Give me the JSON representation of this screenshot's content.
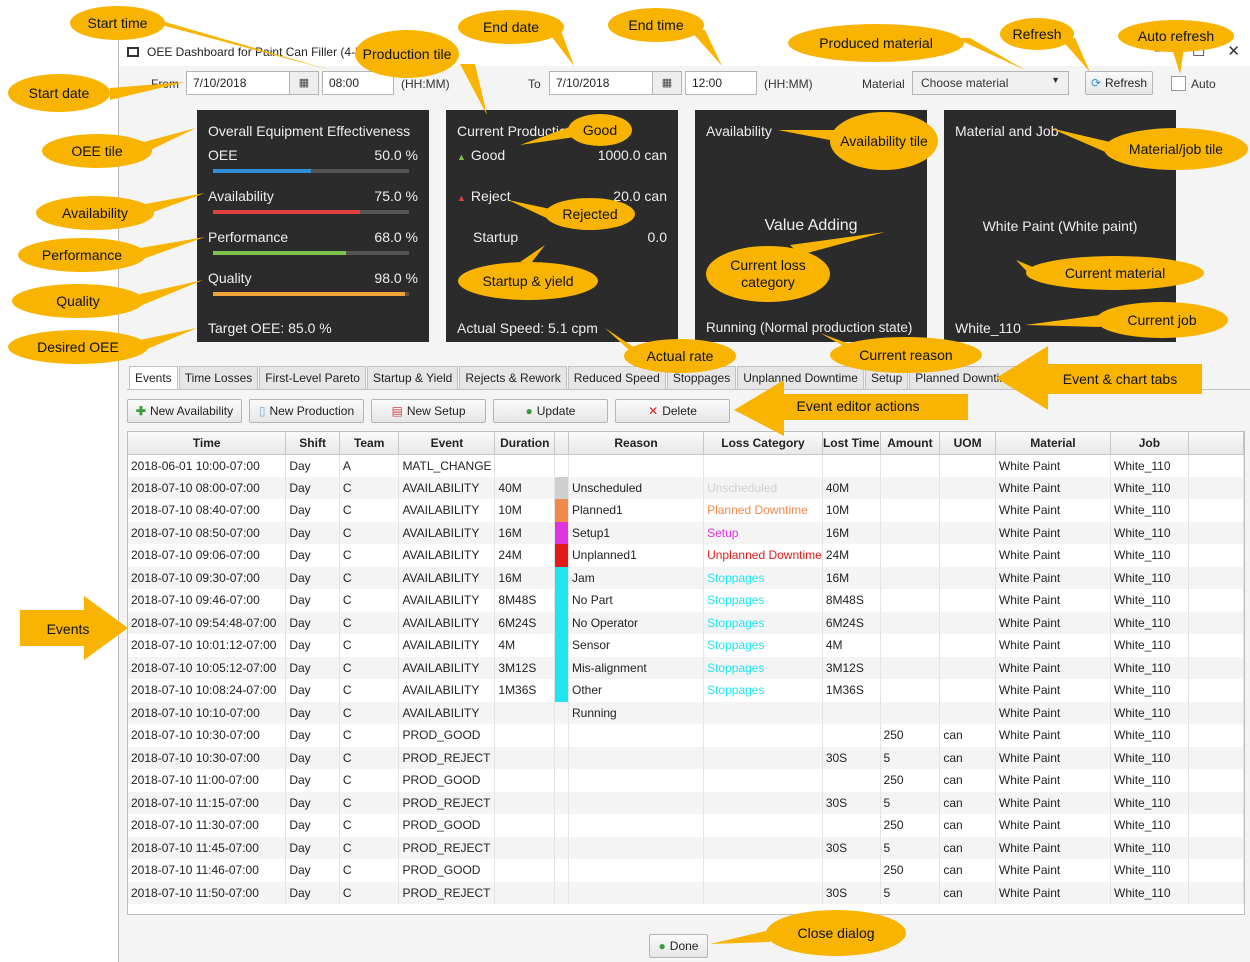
{
  "window": {
    "title": "OEE Dashboard for Paint Can Filler (4-liter machine)",
    "min": "—",
    "max": "☐",
    "close": "✕"
  },
  "range": {
    "from_label": "From",
    "start_date": "7/10/2018",
    "start_time": "08:00",
    "hhmm1": "(HH:MM)",
    "to_label": "To",
    "end_date": "7/10/2018",
    "end_time": "12:00",
    "hhmm2": "(HH:MM)",
    "material_label": "Material",
    "material_placeholder": "Choose material",
    "refresh_label": "Refresh",
    "auto_label": "Auto"
  },
  "oee": {
    "title": "Overall Equipment Effectiveness",
    "rows": [
      {
        "label": "OEE",
        "value": "50.0 %",
        "pct": 0.5,
        "color": "#2f8fd8"
      },
      {
        "label": "Availability",
        "value": "75.0 %",
        "pct": 0.75,
        "color": "#e0413f"
      },
      {
        "label": "Performance",
        "value": "68.0 %",
        "pct": 0.68,
        "color": "#7cc34c"
      },
      {
        "label": "Quality",
        "value": "98.0 %",
        "pct": 0.98,
        "color": "#f0a33a"
      }
    ],
    "target": "Target OEE: 85.0 %"
  },
  "production": {
    "title": "Current Production",
    "good_label": "Good",
    "good_value": "1000.0 can",
    "reject_label": "Reject",
    "reject_value": "20.0 can",
    "startup_label": "Startup",
    "startup_value": "0.0",
    "speed": "Actual Speed: 5.1 cpm"
  },
  "availability": {
    "title": "Availability",
    "category": "Value Adding",
    "reason": "Running (Normal production state)"
  },
  "material": {
    "title": "Material and Job",
    "material": "White Paint (White paint)",
    "job": "White_110"
  },
  "tabs": [
    "Events",
    "Time Losses",
    "First-Level Pareto",
    "Startup & Yield",
    "Rejects & Rework",
    "Reduced Speed",
    "Stoppages",
    "Unplanned Downtime",
    "Setup",
    "Planned Downtime"
  ],
  "actions": {
    "new_availability": "New Availability",
    "new_production": "New Production",
    "new_setup": "New Setup",
    "update": "Update",
    "delete": "Delete"
  },
  "columns": [
    "Time",
    "Shift",
    "Team",
    "Event",
    "Duration",
    "",
    "Reason",
    "Loss Category",
    "Lost Time",
    "Amount",
    "UOM",
    "Material",
    "Job"
  ],
  "rows": [
    [
      "2018-06-01 10:00-07:00",
      "Day",
      "A",
      "MATL_CHANGE",
      "",
      "",
      "",
      "",
      "",
      "",
      "",
      "White Paint",
      "White_110"
    ],
    [
      "2018-07-10 08:00-07:00",
      "Day",
      "C",
      "AVAILABILITY",
      "40M",
      "#cfcfcf",
      "Unscheduled",
      "Unscheduled",
      "40M",
      "",
      "",
      "White Paint",
      "White_110"
    ],
    [
      "2018-07-10 08:40-07:00",
      "Day",
      "C",
      "AVAILABILITY",
      "10M",
      "#f08a4b",
      "Planned1",
      "Planned Downtime",
      "10M",
      "",
      "",
      "White Paint",
      "White_110"
    ],
    [
      "2018-07-10 08:50-07:00",
      "Day",
      "C",
      "AVAILABILITY",
      "16M",
      "#e033e0",
      "Setup1",
      "Setup",
      "16M",
      "",
      "",
      "White Paint",
      "White_110"
    ],
    [
      "2018-07-10 09:06-07:00",
      "Day",
      "C",
      "AVAILABILITY",
      "24M",
      "#e31a1a",
      "Unplanned1",
      "Unplanned Downtime",
      "24M",
      "",
      "",
      "White Paint",
      "White_110"
    ],
    [
      "2018-07-10 09:30-07:00",
      "Day",
      "C",
      "AVAILABILITY",
      "16M",
      "#1ee6f0",
      "Jam",
      "Stoppages",
      "16M",
      "",
      "",
      "White Paint",
      "White_110"
    ],
    [
      "2018-07-10 09:46-07:00",
      "Day",
      "C",
      "AVAILABILITY",
      "8M48S",
      "#1ee6f0",
      "No Part",
      "Stoppages",
      "8M48S",
      "",
      "",
      "White Paint",
      "White_110"
    ],
    [
      "2018-07-10 09:54:48-07:00",
      "Day",
      "C",
      "AVAILABILITY",
      "6M24S",
      "#1ee6f0",
      "No Operator",
      "Stoppages",
      "6M24S",
      "",
      "",
      "White Paint",
      "White_110"
    ],
    [
      "2018-07-10 10:01:12-07:00",
      "Day",
      "C",
      "AVAILABILITY",
      "4M",
      "#1ee6f0",
      "Sensor",
      "Stoppages",
      "4M",
      "",
      "",
      "White Paint",
      "White_110"
    ],
    [
      "2018-07-10 10:05:12-07:00",
      "Day",
      "C",
      "AVAILABILITY",
      "3M12S",
      "#1ee6f0",
      "Mis-alignment",
      "Stoppages",
      "3M12S",
      "",
      "",
      "White Paint",
      "White_110"
    ],
    [
      "2018-07-10 10:08:24-07:00",
      "Day",
      "C",
      "AVAILABILITY",
      "1M36S",
      "#1ee6f0",
      "Other",
      "Stoppages",
      "1M36S",
      "",
      "",
      "White Paint",
      "White_110"
    ],
    [
      "2018-07-10 10:10-07:00",
      "Day",
      "C",
      "AVAILABILITY",
      "",
      "",
      "Running",
      "",
      "",
      "",
      "",
      "White Paint",
      "White_110"
    ],
    [
      "2018-07-10 10:30-07:00",
      "Day",
      "C",
      "PROD_GOOD",
      "",
      "",
      "",
      "",
      "",
      "250",
      "can",
      "White Paint",
      "White_110"
    ],
    [
      "2018-07-10 10:30-07:00",
      "Day",
      "C",
      "PROD_REJECT",
      "",
      "",
      "",
      "",
      "30S",
      "5",
      "can",
      "White Paint",
      "White_110"
    ],
    [
      "2018-07-10 11:00-07:00",
      "Day",
      "C",
      "PROD_GOOD",
      "",
      "",
      "",
      "",
      "",
      "250",
      "can",
      "White Paint",
      "White_110"
    ],
    [
      "2018-07-10 11:15-07:00",
      "Day",
      "C",
      "PROD_REJECT",
      "",
      "",
      "",
      "",
      "30S",
      "5",
      "can",
      "White Paint",
      "White_110"
    ],
    [
      "2018-07-10 11:30-07:00",
      "Day",
      "C",
      "PROD_GOOD",
      "",
      "",
      "",
      "",
      "",
      "250",
      "can",
      "White Paint",
      "White_110"
    ],
    [
      "2018-07-10 11:45-07:00",
      "Day",
      "C",
      "PROD_REJECT",
      "",
      "",
      "",
      "",
      "30S",
      "5",
      "can",
      "White Paint",
      "White_110"
    ],
    [
      "2018-07-10 11:46-07:00",
      "Day",
      "C",
      "PROD_GOOD",
      "",
      "",
      "",
      "",
      "",
      "250",
      "can",
      "White Paint",
      "White_110"
    ],
    [
      "2018-07-10 11:50-07:00",
      "Day",
      "C",
      "PROD_REJECT",
      "",
      "",
      "",
      "",
      "30S",
      "5",
      "can",
      "White Paint",
      "White_110"
    ]
  ],
  "loss_colors": {
    "Unscheduled": "#d0d0d0",
    "Planned Downtime": "#f08a4b",
    "Setup": "#e033e0",
    "Unplanned Downtime": "#e31a1a",
    "Stoppages": "#1ee6f0"
  },
  "done_label": "Done",
  "callouts": {
    "start_time": "Start time",
    "end_date": "End date",
    "end_time": "End time",
    "produced_material": "Produced material",
    "refresh": "Refresh",
    "auto_refresh": "Auto refresh",
    "production_tile": "Production tile",
    "start_date": "Start date",
    "oee_tile": "OEE tile",
    "availability": "Availability",
    "performance": "Performance",
    "quality": "Quality",
    "desired_oee": "Desired OEE",
    "good": "Good",
    "rejected": "Rejected",
    "startup_yield": "Startup & yield",
    "availability_tile": "Availability tile",
    "current_loss": "Current loss category",
    "material_job_tile": "Material/job tile",
    "current_material": "Current material",
    "current_job": "Current job",
    "actual_rate": "Actual rate",
    "current_reason": "Current reason",
    "event_chart_tabs": "Event & chart tabs",
    "event_editor_actions": "Event editor actions",
    "events": "Events",
    "close_dialog": "Close dialog"
  }
}
